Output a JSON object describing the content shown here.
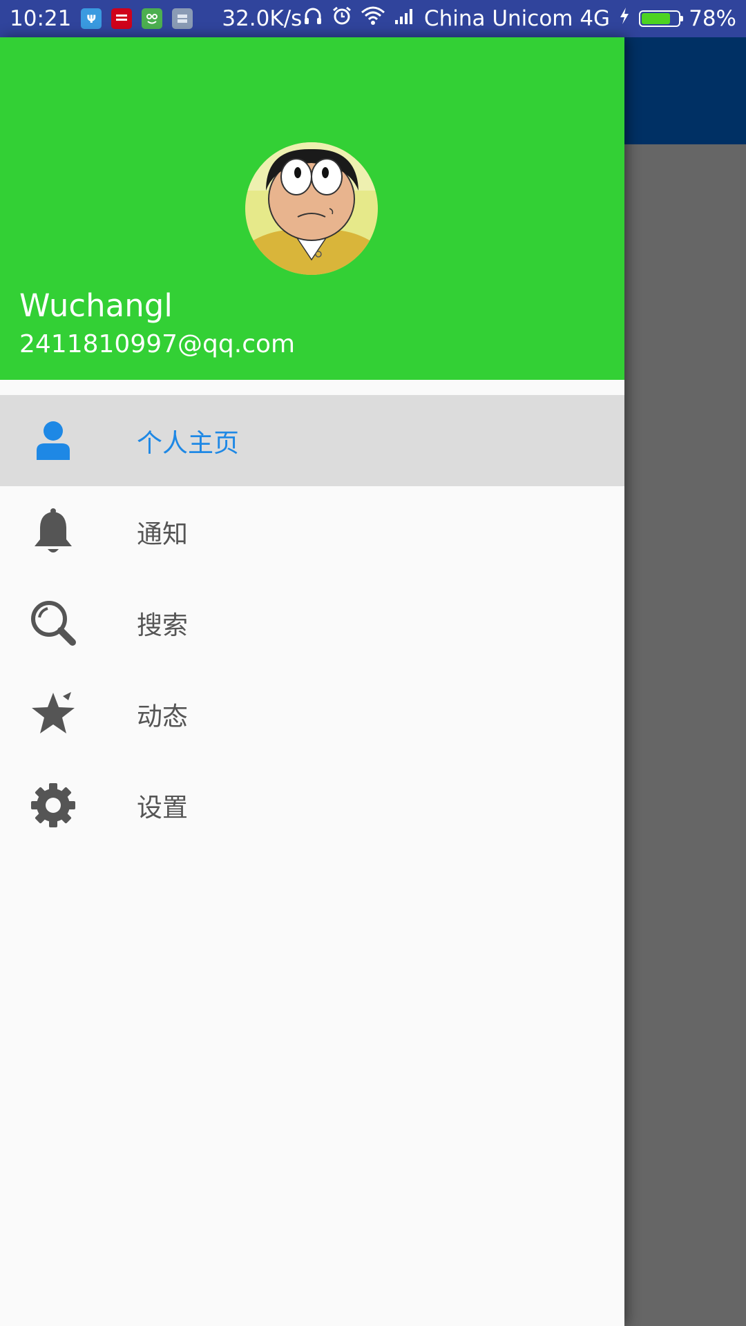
{
  "status_bar": {
    "time": "10:21",
    "speed": "32.0K/s",
    "carrier": "China  Unicom  4G",
    "battery_percent": "78%",
    "battery_level": 0.78,
    "notification_icons": [
      "usb-icon",
      "youdao-app-icon",
      "frog-app-icon",
      "storage-app-icon"
    ],
    "system_icons": [
      "headphones-icon",
      "alarm-icon",
      "wifi-icon",
      "signal-icon",
      "charging-icon",
      "battery-icon"
    ]
  },
  "drawer": {
    "header": {
      "background_color": "#33d035",
      "user_name": "Wuchangl",
      "email": "2411810997@qq.com",
      "avatar": "cartoon-boy-avatar"
    },
    "menu": [
      {
        "icon": "person-icon",
        "label": "个人主页",
        "selected": true
      },
      {
        "icon": "bell-icon",
        "label": "通知",
        "selected": false
      },
      {
        "icon": "search-icon",
        "label": "搜索",
        "selected": false
      },
      {
        "icon": "star-icon",
        "label": "动态",
        "selected": false
      },
      {
        "icon": "gear-icon",
        "label": "设置",
        "selected": false
      }
    ],
    "colors": {
      "selected_text": "#1e88e5",
      "normal_text": "#555555",
      "selected_bg": "#dcdcdc"
    }
  },
  "background_app": {
    "appbar_color": "#003064"
  }
}
